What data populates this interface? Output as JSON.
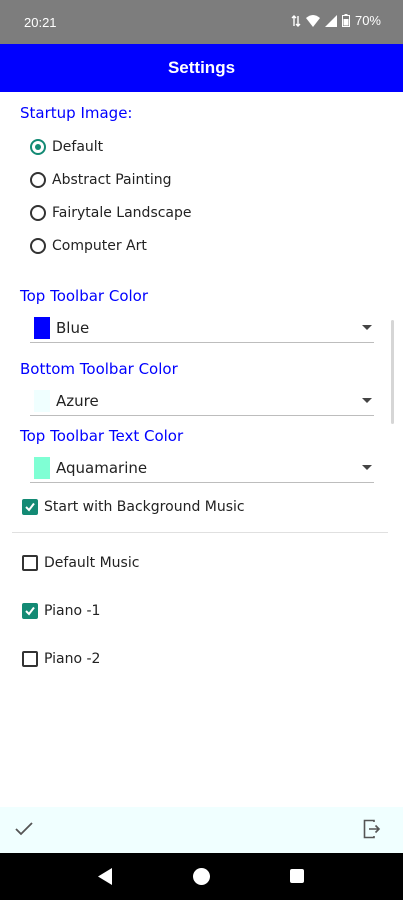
{
  "status_bar": {
    "time": "20:21",
    "battery": "70%"
  },
  "toolbar": {
    "title": "Settings"
  },
  "startup_image": {
    "label": "Startup Image:",
    "options": [
      {
        "label": "Default",
        "selected": true
      },
      {
        "label": "Abstract Painting",
        "selected": false
      },
      {
        "label": "Fairytale Landscape",
        "selected": false
      },
      {
        "label": "Computer Art",
        "selected": false
      }
    ]
  },
  "top_toolbar_color": {
    "label": "Top Toolbar Color",
    "value": "Blue",
    "swatch": "#0000ff"
  },
  "bottom_toolbar_color": {
    "label": "Bottom Toolbar Color",
    "value": "Azure",
    "swatch": "#f0ffff"
  },
  "top_toolbar_text_color": {
    "label": "Top Toolbar Text Color",
    "value": "Aquamarine",
    "swatch": "#7fffd4"
  },
  "background_music": {
    "label": "Start with Background Music",
    "checked": true
  },
  "music_options": [
    {
      "label": "Default Music",
      "checked": false
    },
    {
      "label": "Piano -1",
      "checked": true
    },
    {
      "label": "Piano -2",
      "checked": false
    }
  ],
  "colors": {
    "accent": "#138a74",
    "top_toolbar": "#0000ff",
    "bottom_toolbar": "#f0ffff"
  },
  "icons": {
    "ok": "checkmark-icon",
    "exit": "exit-icon"
  }
}
